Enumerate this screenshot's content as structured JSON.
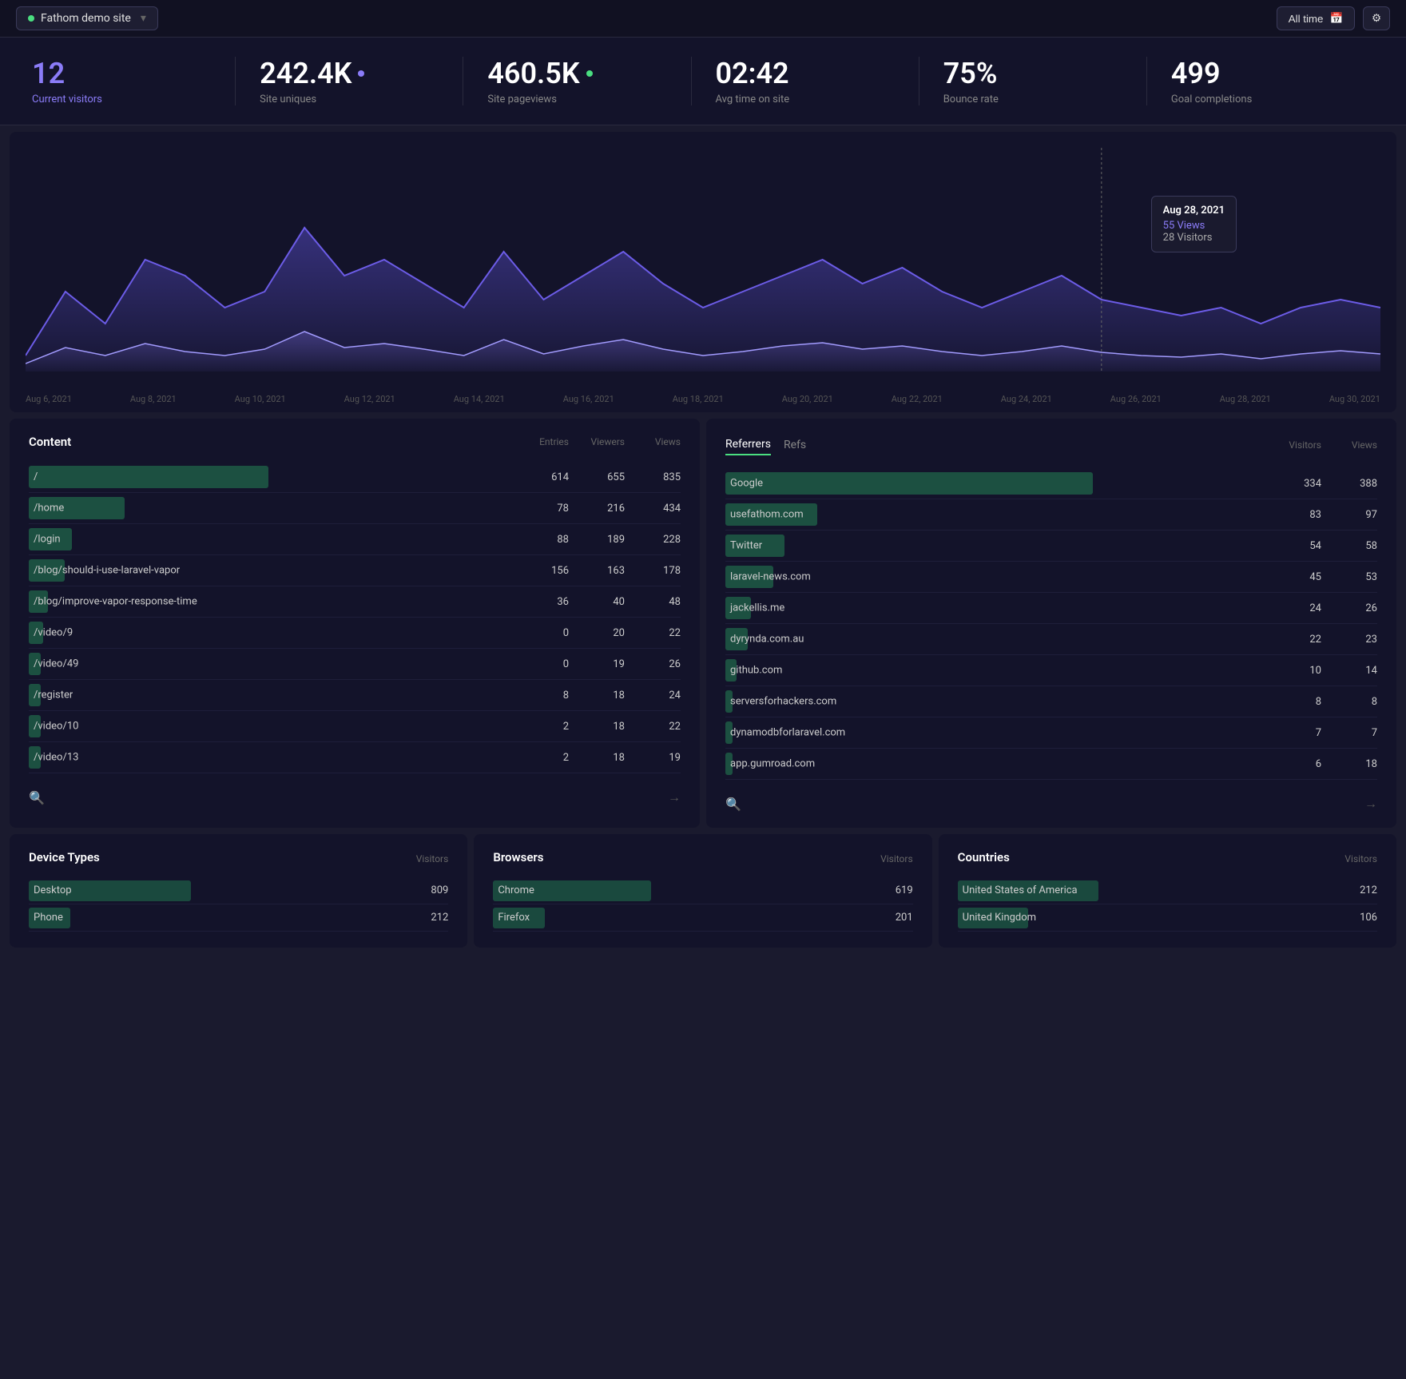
{
  "header": {
    "site_name": "Fathom demo site",
    "time_range": "All time",
    "site_dot_color": "#4ade80"
  },
  "stats": {
    "current_visitors": {
      "value": "12",
      "label": "Current visitors"
    },
    "site_uniques": {
      "value": "242.4K",
      "label": "Site uniques",
      "dot": "#8b7cf8"
    },
    "site_pageviews": {
      "value": "460.5K",
      "label": "Site pageviews",
      "dot": "#4ade80"
    },
    "avg_time": {
      "value": "02:42",
      "label": "Avg time on site"
    },
    "bounce_rate": {
      "value": "75%",
      "label": "Bounce rate"
    },
    "goal_completions": {
      "value": "499",
      "label": "Goal completions"
    }
  },
  "chart": {
    "tooltip": {
      "date": "Aug 28, 2021",
      "views_label": "55 Views",
      "visitors_label": "28 Visitors"
    },
    "x_labels": [
      "Aug 6, 2021",
      "Aug 8, 2021",
      "Aug 10, 2021",
      "Aug 12, 2021",
      "Aug 14, 2021",
      "Aug 16, 2021",
      "Aug 18, 2021",
      "Aug 20, 2021",
      "Aug 22, 2021",
      "Aug 24, 2021",
      "Aug 26, 2021",
      "Aug 28, 2021",
      "Aug 30, 2021"
    ]
  },
  "content_table": {
    "title": "Content",
    "columns": [
      "Entries",
      "Viewers",
      "Views"
    ],
    "rows": [
      {
        "label": "/",
        "entries": "614",
        "viewers": "655",
        "views": "835",
        "bar_pct": 100
      },
      {
        "label": "/home",
        "entries": "78",
        "viewers": "216",
        "views": "434",
        "bar_pct": 40
      },
      {
        "label": "/login",
        "entries": "88",
        "viewers": "189",
        "views": "228",
        "bar_pct": 18
      },
      {
        "label": "/blog/should-i-use-laravel-vapor",
        "entries": "156",
        "viewers": "163",
        "views": "178",
        "bar_pct": 15
      },
      {
        "label": "/blog/improve-vapor-response-time",
        "entries": "36",
        "viewers": "40",
        "views": "48",
        "bar_pct": 8
      },
      {
        "label": "/video/9",
        "entries": "0",
        "viewers": "20",
        "views": "22",
        "bar_pct": 6
      },
      {
        "label": "/video/49",
        "entries": "0",
        "viewers": "19",
        "views": "26",
        "bar_pct": 5
      },
      {
        "label": "/register",
        "entries": "8",
        "viewers": "18",
        "views": "24",
        "bar_pct": 5
      },
      {
        "label": "/video/10",
        "entries": "2",
        "viewers": "18",
        "views": "22",
        "bar_pct": 5
      },
      {
        "label": "/video/13",
        "entries": "2",
        "viewers": "18",
        "views": "19",
        "bar_pct": 5
      }
    ]
  },
  "referrers_table": {
    "title": "Referrers",
    "tabs": [
      "Referrers",
      "Refs"
    ],
    "active_tab": "Referrers",
    "columns": [
      "Visitors",
      "Views"
    ],
    "rows": [
      {
        "label": "Google",
        "visitors": "334",
        "views": "388",
        "bar_pct": 100
      },
      {
        "label": "usefathom.com",
        "visitors": "83",
        "views": "97",
        "bar_pct": 25
      },
      {
        "label": "Twitter",
        "visitors": "54",
        "views": "58",
        "bar_pct": 16
      },
      {
        "label": "laravel-news.com",
        "visitors": "45",
        "views": "53",
        "bar_pct": 13
      },
      {
        "label": "jackellis.me",
        "visitors": "24",
        "views": "26",
        "bar_pct": 7
      },
      {
        "label": "dyrynda.com.au",
        "visitors": "22",
        "views": "23",
        "bar_pct": 6
      },
      {
        "label": "github.com",
        "visitors": "10",
        "views": "14",
        "bar_pct": 3
      },
      {
        "label": "serversforhackers.com",
        "visitors": "8",
        "views": "8",
        "bar_pct": 2
      },
      {
        "label": "dynamodbforlaravel.com",
        "visitors": "7",
        "views": "7",
        "bar_pct": 2
      },
      {
        "label": "app.gumroad.com",
        "visitors": "6",
        "views": "18",
        "bar_pct": 2
      }
    ]
  },
  "device_types": {
    "title": "Device Types",
    "col_label": "Visitors",
    "rows": [
      {
        "label": "Desktop",
        "value": "809",
        "bar_pct": 78
      },
      {
        "label": "Phone",
        "value": "212",
        "bar_pct": 20
      }
    ]
  },
  "browsers": {
    "title": "Browsers",
    "col_label": "Visitors",
    "rows": [
      {
        "label": "Chrome",
        "value": "619",
        "bar_pct": 76
      },
      {
        "label": "Firefox",
        "value": "201",
        "bar_pct": 25
      }
    ]
  },
  "countries": {
    "title": "Countries",
    "col_label": "Visitors",
    "rows": [
      {
        "label": "United States of America",
        "value": "212",
        "bar_pct": 68
      },
      {
        "label": "United Kingdom",
        "value": "106",
        "bar_pct": 34
      }
    ]
  },
  "bar_color": "#2d6a4f",
  "bar_color_teal": "#1e7a5a"
}
